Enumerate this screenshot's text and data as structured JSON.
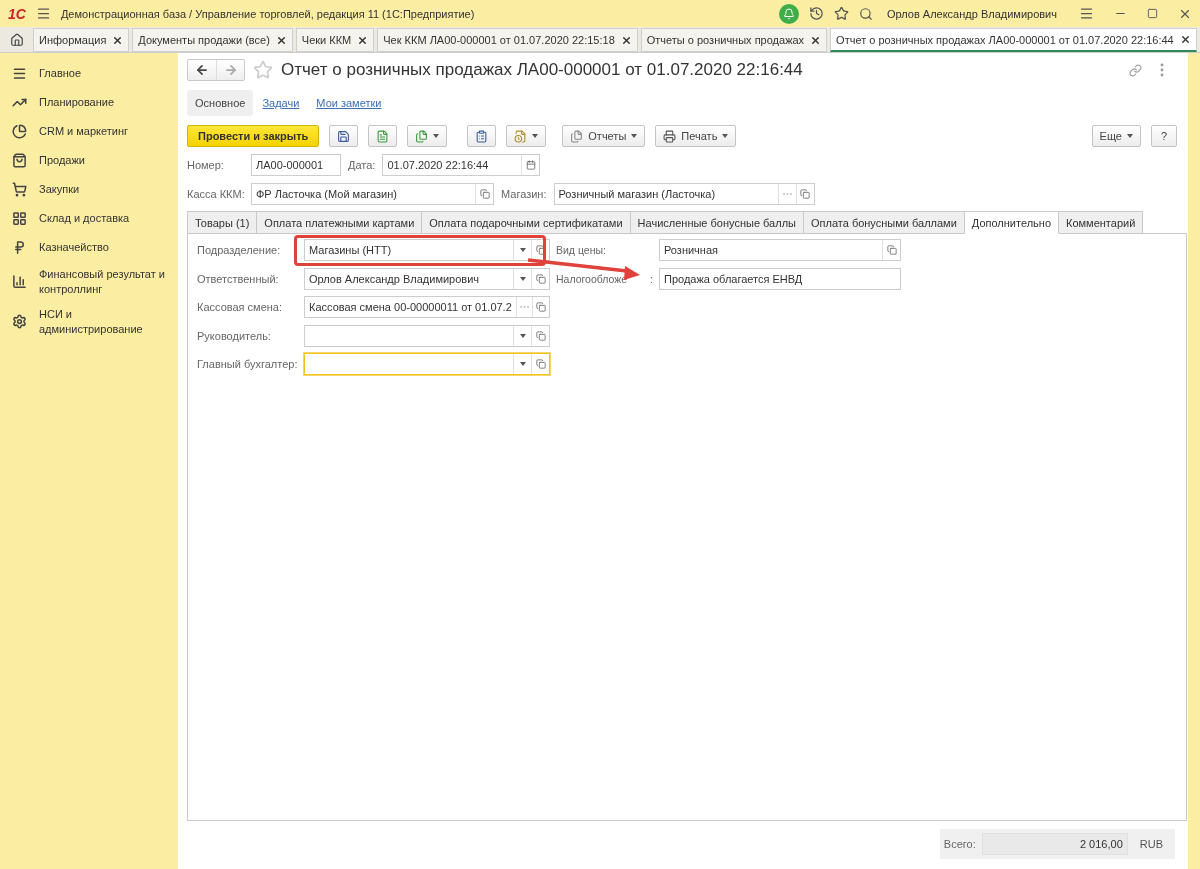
{
  "app": {
    "logo": "1С",
    "title": "Демонстрационная база / Управление торговлей, редакция 11  (1С:Предприятие)",
    "user": "Орлов Александр Владимирович"
  },
  "open_tabs": [
    {
      "label": "Информация",
      "selected": false
    },
    {
      "label": "Документы продажи (все)",
      "selected": false
    },
    {
      "label": "Чеки ККМ",
      "selected": false
    },
    {
      "label": "Чек ККМ ЛА00-000001 от 01.07.2020 22:15:18",
      "selected": false
    },
    {
      "label": "Отчеты о розничных продажах",
      "selected": false
    },
    {
      "label": "Отчет о розничных продажах ЛА00-000001 от 01.07.2020 22:16:44",
      "selected": true
    }
  ],
  "sidebar": {
    "items": [
      {
        "label": "Главное"
      },
      {
        "label": "Планирование"
      },
      {
        "label": "CRM и маркетинг"
      },
      {
        "label": "Продажи"
      },
      {
        "label": "Закупки"
      },
      {
        "label": "Склад и доставка"
      },
      {
        "label": "Казначейство"
      },
      {
        "label": "Финансовый результат и контроллинг"
      },
      {
        "label": "НСИ и администрирование"
      }
    ]
  },
  "document": {
    "title": "Отчет о розничных продажах ЛА00-000001 от 01.07.2020 22:16:44",
    "favorite": false,
    "sections": [
      {
        "label": "Основное",
        "selected": true
      },
      {
        "label": "Задачи",
        "selected": false
      },
      {
        "label": "Мои заметки",
        "selected": false
      }
    ],
    "toolbar": {
      "primary": "Провести и закрыть",
      "reports": "Отчеты",
      "print": "Печать",
      "more": "Еще",
      "help": "?"
    },
    "header_rows": [
      [
        {
          "label": "Номер:",
          "value": "ЛА00-000001",
          "kind": "text"
        },
        {
          "label": "Дата:",
          "value": "01.07.2020 22:16:44",
          "kind": "date"
        }
      ],
      [
        {
          "label": "Касса ККМ:",
          "value": "ФР Ласточка (Мой магазин)",
          "kind": "open"
        },
        {
          "label": "Магазин:",
          "value": "Розничный магазин (Ласточка)",
          "kind": "choice"
        }
      ]
    ],
    "tabs": [
      {
        "label": "Товары (1)",
        "selected": false
      },
      {
        "label": "Оплата платежными картами",
        "selected": false
      },
      {
        "label": "Оплата подарочными сертификатами",
        "selected": false
      },
      {
        "label": "Начисленные бонусные баллы",
        "selected": false
      },
      {
        "label": "Оплата бонусными баллами",
        "selected": false
      },
      {
        "label": "Дополнительно",
        "selected": true
      },
      {
        "label": "Комментарий",
        "selected": false
      }
    ],
    "left_fields": [
      {
        "label": "Подразделение:",
        "value": "Магазины (НТТ)",
        "kind": "combo",
        "focused": false
      },
      {
        "label": "Ответственный:",
        "value": "Орлов Александр Владимирович",
        "kind": "combo",
        "focused": false
      },
      {
        "label": "Кассовая смена:",
        "value": "Кассовая смена 00-00000011 от 01.07.2",
        "kind": "choice",
        "focused": false
      },
      {
        "label": "Руководитель:",
        "kind": "combo",
        "focused": false
      },
      {
        "label": "Главный бухгалтер:",
        "kind": "combo",
        "focused": true
      }
    ],
    "right_fields": [
      {
        "label": "Вид цены:",
        "value": "Розничная",
        "kind": "open"
      },
      {
        "label": "Налогообложе",
        "label_tail": ":",
        "value": "Продажа облагается ЕНВД",
        "kind": "text"
      }
    ],
    "annotations": {
      "highlight_frame": true,
      "arrow": true
    },
    "total": {
      "label": "Всего:",
      "value": "2 016,00",
      "currency": "RUB"
    }
  }
}
